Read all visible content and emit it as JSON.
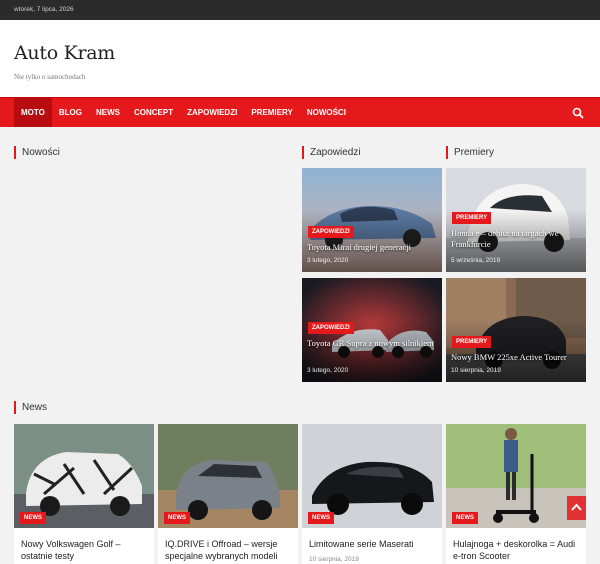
{
  "topbar": {
    "date": "wtorek, 7 lipca, 2026"
  },
  "site": {
    "title": "Auto Kram",
    "tagline": "Nie tylko o samochodach"
  },
  "nav": {
    "items": [
      "MOTO",
      "BLOG",
      "NEWS",
      "CONCEPT",
      "ZAPOWIEDZI",
      "PREMIERY",
      "NOWOŚCI"
    ]
  },
  "sections": {
    "nowosci": "Nowości",
    "zapowiedzi": "Zapowiedzi",
    "premiery": "Premiery",
    "news": "News"
  },
  "zapowiedzi": [
    {
      "badge": "ZAPOWIEDZI",
      "title": "Toyota Mirai drugiej generacji",
      "date": "3 lutego, 2020"
    },
    {
      "badge": "ZAPOWIEDZI",
      "title": "Toyota GR Supra z nowym silnikiem",
      "date": "3 lutego, 2020"
    }
  ],
  "premiery": [
    {
      "badge": "PREMIERY",
      "title": "Honda e – debiut na targach we Frankfurcie",
      "date": "5 września, 2019"
    },
    {
      "badge": "PREMIERY",
      "title": "Nowy BMW 225xe Active Tourer",
      "date": "10 sierpnia, 2019"
    }
  ],
  "news": [
    {
      "badge": "NEWS",
      "title": "Nowy Volkswagen Golf – ostatnie testy",
      "date": ""
    },
    {
      "badge": "NEWS",
      "title": "IQ.DRIVE i Offroad – wersje specjalne wybranych modeli",
      "date": ""
    },
    {
      "badge": "NEWS",
      "title": "Limitowane serie Maserati",
      "date": "10 sierpnia, 2019"
    },
    {
      "badge": "NEWS",
      "title": "Hulajnoga + deskorolka = Audi e-tron Scooter",
      "date": ""
    }
  ],
  "colors": {
    "accent": "#e5191c",
    "topbar": "#2b2b2b"
  }
}
